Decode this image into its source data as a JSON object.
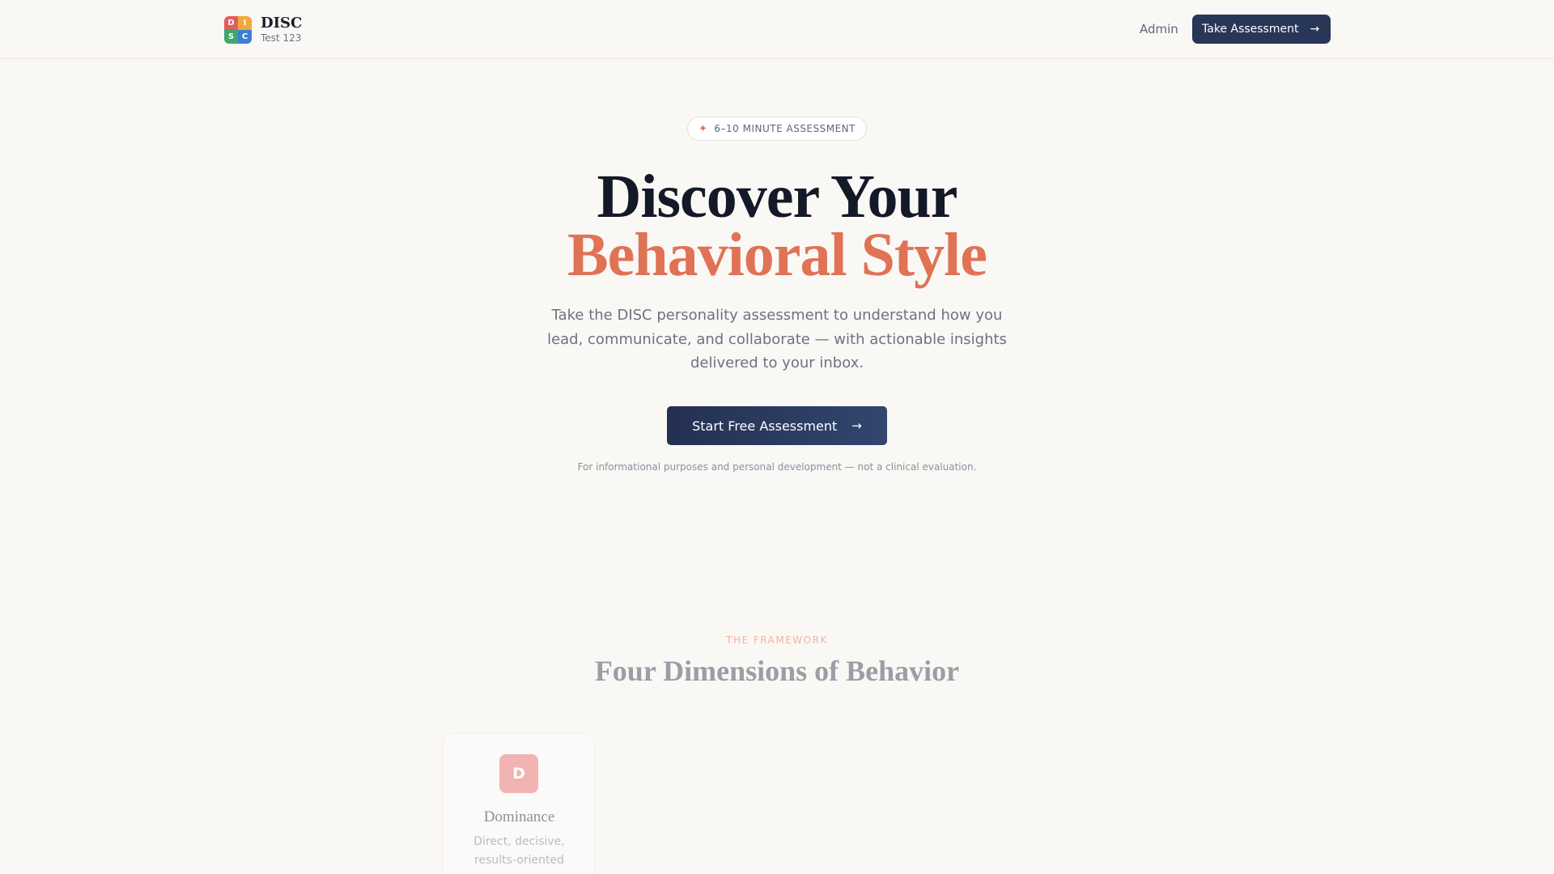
{
  "header": {
    "brand_title": "DISC",
    "brand_subtitle": "Test 123",
    "logo_letters": [
      {
        "letter": "D",
        "color": "#e35d5b"
      },
      {
        "letter": "I",
        "color": "#f2a93b"
      },
      {
        "letter": "S",
        "color": "#3ea86b"
      },
      {
        "letter": "C",
        "color": "#3b7fd6"
      }
    ],
    "admin_label": "Admin",
    "cta_label": "Take Assessment"
  },
  "hero": {
    "badge": "6–10 MINUTE ASSESSMENT",
    "title_line1": "Discover Your",
    "title_line2": "Behavioral Style",
    "description": "Take the DISC personality assessment to understand how you lead, communicate, and collaborate — with actionable insights delivered to your inbox.",
    "cta_label": "Start Free Assessment",
    "disclaimer": "For informational purposes and personal development — not a clinical evaluation."
  },
  "framework": {
    "eyebrow": "THE FRAMEWORK",
    "title": "Four Dimensions of Behavior",
    "cards": [
      {
        "letter": "D",
        "title": "Dominance",
        "description": "Direct, decisive, results-oriented"
      }
    ]
  },
  "colors": {
    "accent": "#e07256",
    "primary": "#283658",
    "background": "#faf8f5"
  }
}
